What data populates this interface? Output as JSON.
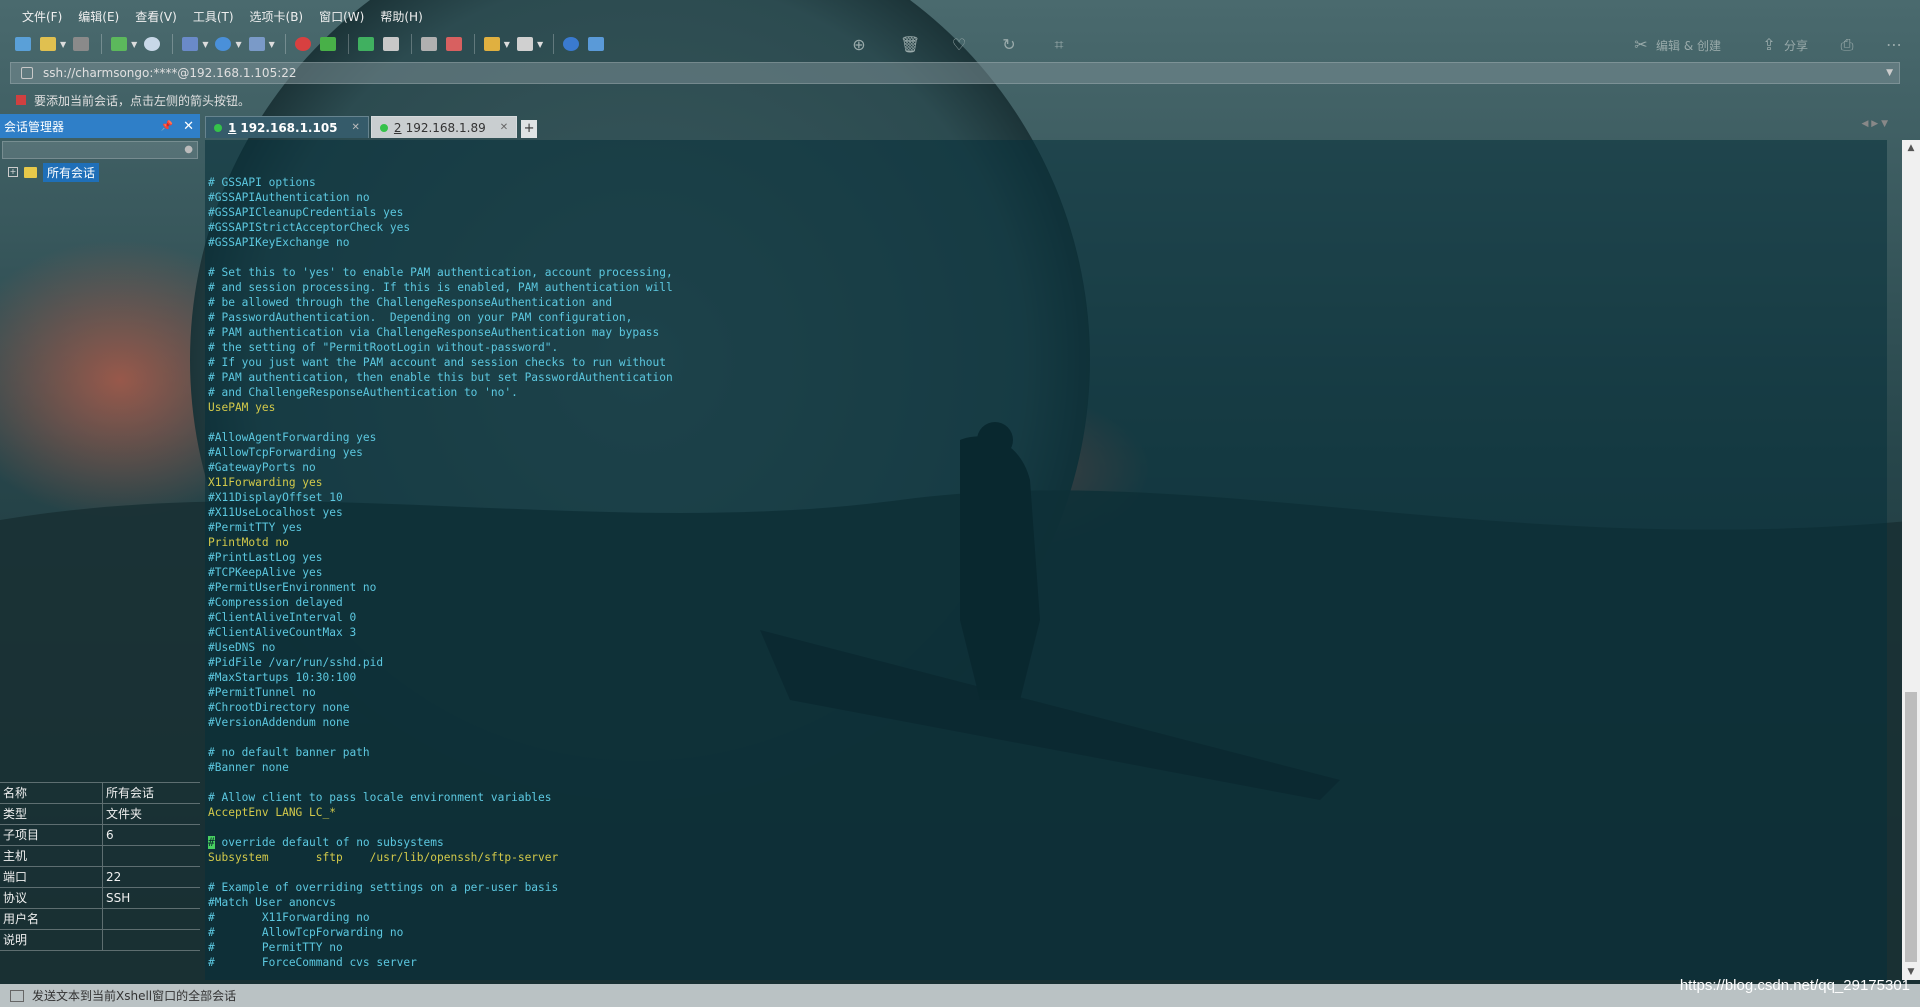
{
  "menu": [
    "文件(F)",
    "编辑(E)",
    "查看(V)",
    "工具(T)",
    "选项卡(B)",
    "窗口(W)",
    "帮助(H)"
  ],
  "toolbar_right": {
    "edit_create": "编辑 & 创建",
    "share": "分享"
  },
  "address": {
    "value": "ssh://charmsongo:****@192.168.1.105:22"
  },
  "hint": {
    "text": "要添加当前会话，点击左侧的箭头按钮。"
  },
  "session_manager": {
    "title": "会话管理器",
    "tree_root": "所有会话"
  },
  "properties": [
    {
      "key": "名称",
      "value": "所有会话"
    },
    {
      "key": "类型",
      "value": "文件夹"
    },
    {
      "key": "子项目",
      "value": "6"
    },
    {
      "key": "主机",
      "value": ""
    },
    {
      "key": "端口",
      "value": "22"
    },
    {
      "key": "协议",
      "value": "SSH"
    },
    {
      "key": "用户名",
      "value": ""
    },
    {
      "key": "说明",
      "value": ""
    }
  ],
  "tabs": [
    {
      "num": "1",
      "label": "192.168.1.105",
      "active": true
    },
    {
      "num": "2",
      "label": "192.168.1.89",
      "active": false
    }
  ],
  "terminal": {
    "lines": [
      {
        "text": "# GSSAPI options",
        "color": "cyan"
      },
      {
        "text": "#GSSAPIAuthentication no",
        "color": "cyan"
      },
      {
        "text": "#GSSAPICleanupCredentials yes",
        "color": "cyan"
      },
      {
        "text": "#GSSAPIStrictAcceptorCheck yes",
        "color": "cyan"
      },
      {
        "text": "#GSSAPIKeyExchange no",
        "color": "cyan"
      },
      {
        "text": "",
        "color": "cyan"
      },
      {
        "text": "# Set this to 'yes' to enable PAM authentication, account processing,",
        "color": "cyan"
      },
      {
        "text": "# and session processing. If this is enabled, PAM authentication will",
        "color": "cyan"
      },
      {
        "text": "# be allowed through the ChallengeResponseAuthentication and",
        "color": "cyan"
      },
      {
        "text": "# PasswordAuthentication.  Depending on your PAM configuration,",
        "color": "cyan"
      },
      {
        "text": "# PAM authentication via ChallengeResponseAuthentication may bypass",
        "color": "cyan"
      },
      {
        "text": "# the setting of \"PermitRootLogin without-password\".",
        "color": "cyan"
      },
      {
        "text": "# If you just want the PAM account and session checks to run without",
        "color": "cyan"
      },
      {
        "text": "# PAM authentication, then enable this but set PasswordAuthentication",
        "color": "cyan"
      },
      {
        "text": "# and ChallengeResponseAuthentication to 'no'.",
        "color": "cyan"
      },
      {
        "text": "UsePAM yes",
        "color": "yellow"
      },
      {
        "text": "",
        "color": "cyan"
      },
      {
        "text": "#AllowAgentForwarding yes",
        "color": "cyan"
      },
      {
        "text": "#AllowTcpForwarding yes",
        "color": "cyan"
      },
      {
        "text": "#GatewayPorts no",
        "color": "cyan"
      },
      {
        "text": "X11Forwarding yes",
        "color": "yellow"
      },
      {
        "text": "#X11DisplayOffset 10",
        "color": "cyan"
      },
      {
        "text": "#X11UseLocalhost yes",
        "color": "cyan"
      },
      {
        "text": "#PermitTTY yes",
        "color": "cyan"
      },
      {
        "text": "PrintMotd no",
        "color": "yellow"
      },
      {
        "text": "#PrintLastLog yes",
        "color": "cyan"
      },
      {
        "text": "#TCPKeepAlive yes",
        "color": "cyan"
      },
      {
        "text": "#PermitUserEnvironment no",
        "color": "cyan"
      },
      {
        "text": "#Compression delayed",
        "color": "cyan"
      },
      {
        "text": "#ClientAliveInterval 0",
        "color": "cyan"
      },
      {
        "text": "#ClientAliveCountMax 3",
        "color": "cyan"
      },
      {
        "text": "#UseDNS no",
        "color": "cyan"
      },
      {
        "text": "#PidFile /var/run/sshd.pid",
        "color": "cyan"
      },
      {
        "text": "#MaxStartups 10:30:100",
        "color": "cyan"
      },
      {
        "text": "#PermitTunnel no",
        "color": "cyan"
      },
      {
        "text": "#ChrootDirectory none",
        "color": "cyan"
      },
      {
        "text": "#VersionAddendum none",
        "color": "cyan"
      },
      {
        "text": "",
        "color": "cyan"
      },
      {
        "text": "# no default banner path",
        "color": "cyan"
      },
      {
        "text": "#Banner none",
        "color": "cyan"
      },
      {
        "text": "",
        "color": "cyan"
      },
      {
        "text": "# Allow client to pass locale environment variables",
        "color": "cyan"
      },
      {
        "text": "AcceptEnv LANG LC_*",
        "color": "yellow"
      },
      {
        "text": "",
        "color": "cyan"
      },
      {
        "text": "# override default of no subsystems",
        "color": "cyan",
        "cursor": true
      },
      {
        "text": "Subsystem       sftp    /usr/lib/openssh/sftp-server",
        "color": "yellow"
      },
      {
        "text": "",
        "color": "cyan"
      },
      {
        "text": "# Example of overriding settings on a per-user basis",
        "color": "cyan"
      },
      {
        "text": "#Match User anoncvs",
        "color": "cyan"
      },
      {
        "text": "#       X11Forwarding no",
        "color": "cyan"
      },
      {
        "text": "#       AllowTcpForwarding no",
        "color": "cyan"
      },
      {
        "text": "#       PermitTTY no",
        "color": "cyan"
      },
      {
        "text": "#       ForceCommand cvs server",
        "color": "cyan"
      }
    ]
  },
  "statusbar": {
    "text": "发送文本到当前Xshell窗口的全部会话"
  },
  "watermark": "https://blog.csdn.net/qq_29175301",
  "colors": {
    "comment": "#5cc8e0",
    "directive": "#d2c94a",
    "panel_header": "#2f7fc8",
    "tab_active": "#355b6a",
    "status_dot": "#35c24a"
  },
  "icons": {
    "toolbar": [
      "new-session-icon",
      "open-folder-icon",
      "reconnect-icon",
      "new-tab-icon",
      "find-icon",
      "transfer-icon",
      "globe-icon",
      "font-icon",
      "xftp-icon",
      "xmanager-icon",
      "fullscreen-icon",
      "lock-icon",
      "keyboard-icon",
      "highlight-icon",
      "session-folder-icon",
      "layout-icon",
      "help-icon",
      "chat-icon"
    ],
    "toolbar_right": [
      "zoom-in-icon",
      "delete-icon",
      "heart-icon",
      "rotate-icon",
      "crop-icon",
      "edit-create-icon",
      "share-icon",
      "print-icon",
      "more-icon"
    ]
  }
}
